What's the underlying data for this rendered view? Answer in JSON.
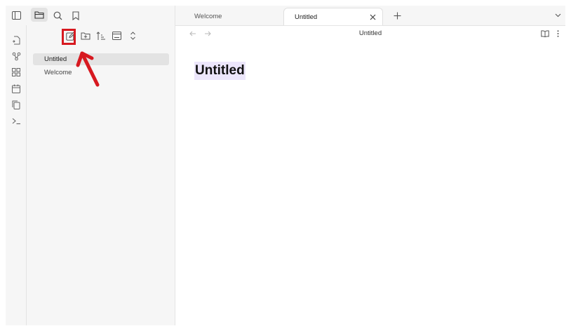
{
  "tabs": [
    {
      "label": "Welcome",
      "active": false
    },
    {
      "label": "Untitled",
      "active": true
    }
  ],
  "view_header": {
    "title": "Untitled"
  },
  "editor": {
    "note_title": "Untitled"
  },
  "file_explorer": {
    "files": [
      {
        "label": "Untitled",
        "active": true
      },
      {
        "label": "Welcome",
        "active": false
      }
    ],
    "toolbar": [
      "new-note",
      "new-folder",
      "sort",
      "auto-reveal",
      "collapse-expand"
    ]
  },
  "ribbon": [
    "open-quick-switcher",
    "open-graph-view",
    "open-canvas",
    "open-daily-note",
    "insert-template",
    "open-command-palette"
  ],
  "colors": {
    "accent_highlight": "#d71920",
    "title_highlight": "#ece6fb",
    "pane_bg": "#f6f6f6"
  }
}
